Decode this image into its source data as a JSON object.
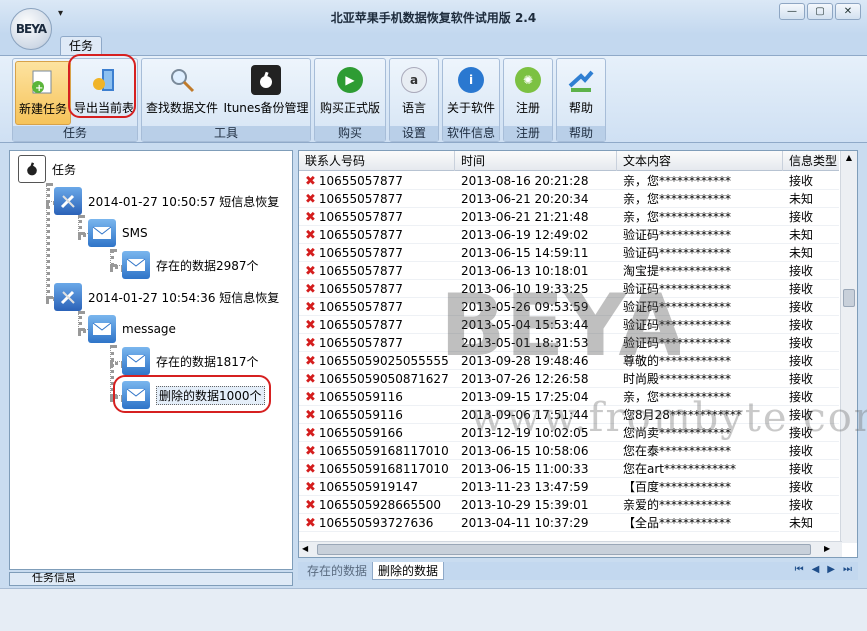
{
  "window": {
    "title": "北亚苹果手机数据恢复软件试用版 2.4",
    "logo": "BEYA",
    "qat_symbol": "▾"
  },
  "ribbon": {
    "tab": "任务",
    "groups": [
      {
        "label": "任务",
        "buttons": [
          {
            "label": "新建任务",
            "icon": "new-task-icon"
          },
          {
            "label": "导出当前表",
            "icon": "export-icon"
          }
        ]
      },
      {
        "label": "工具",
        "buttons": [
          {
            "label": "查找数据文件",
            "icon": "search-icon"
          },
          {
            "label": "Itunes备份管理",
            "icon": "apple-icon"
          }
        ]
      },
      {
        "label": "购买",
        "buttons": [
          {
            "label": "购买正式版",
            "icon": "play-icon"
          }
        ]
      },
      {
        "label": "设置",
        "buttons": [
          {
            "label": "语言",
            "icon": "language-icon"
          }
        ]
      },
      {
        "label": "软件信息",
        "buttons": [
          {
            "label": "关于软件",
            "icon": "info-icon"
          }
        ]
      },
      {
        "label": "注册",
        "buttons": [
          {
            "label": "注册",
            "icon": "register-icon"
          }
        ]
      },
      {
        "label": "帮助",
        "buttons": [
          {
            "label": "帮助",
            "icon": "help-icon"
          }
        ]
      }
    ]
  },
  "tree": {
    "root": "任务",
    "task1": "2014-01-27 10:50:57 短信息恢复",
    "task1_sms": "SMS",
    "task1_existing": "存在的数据2987个",
    "task2": "2014-01-27 10:54:36 短信息恢复",
    "task2_message": "message",
    "task2_existing": "存在的数据1817个",
    "task2_deleted": "删除的数据1000个",
    "bottom_label": "任务信息"
  },
  "table": {
    "headers": [
      "联系人号码",
      "时间",
      "文本内容",
      "信息类型"
    ],
    "rows": [
      [
        "10655057877",
        "2013-08-16  20:21:28",
        "亲，您************",
        "接收"
      ],
      [
        "10655057877",
        "2013-06-21  20:20:34",
        "亲，您************",
        "未知"
      ],
      [
        "10655057877",
        "2013-06-21  21:21:48",
        "亲，您************",
        "接收"
      ],
      [
        "10655057877",
        "2013-06-19  12:49:02",
        "验证码************",
        "未知"
      ],
      [
        "10655057877",
        "2013-06-15  14:59:11",
        "验证码************",
        "未知"
      ],
      [
        "10655057877",
        "2013-06-13  10:18:01",
        "淘宝提************",
        "接收"
      ],
      [
        "10655057877",
        "2013-06-10  19:33:25",
        "验证码************",
        "接收"
      ],
      [
        "10655057877",
        "2013-05-26  09:53:59",
        "验证码************",
        "接收"
      ],
      [
        "10655057877",
        "2013-05-04  15:53:44",
        "验证码************",
        "接收"
      ],
      [
        "10655057877",
        "2013-05-01  18:31:53",
        "验证码************",
        "接收"
      ],
      [
        "10655059025055555",
        "2013-09-28  19:48:46",
        "尊敬的************",
        "接收"
      ],
      [
        "10655059050871627",
        "2013-07-26  12:26:58",
        "时尚殿************",
        "接收"
      ],
      [
        "10655059116",
        "2013-09-15  17:25:04",
        "亲，您************",
        "接收"
      ],
      [
        "10655059116",
        "2013-09-06  17:51:44",
        "您8月28************",
        "接收"
      ],
      [
        "10655059166",
        "2013-12-19  10:02:05",
        "您尚卖************",
        "接收"
      ],
      [
        "10655059168117010",
        "2013-06-15  10:58:06",
        "您在泰************",
        "接收"
      ],
      [
        "10655059168117010",
        "2013-06-15  11:00:33",
        "您在art************",
        "接收"
      ],
      [
        "106550591914​7",
        "2013-11-23  13:47:59",
        "【百度************",
        "接收"
      ],
      [
        "10655059286655​00",
        "2013-10-29  15:39:01",
        "亲爱的************",
        "接收"
      ],
      [
        "10655059372763​6",
        "2013-04-11  10:37:29",
        "【全品************",
        "未知"
      ]
    ]
  },
  "watermark": {
    "text": "BEYA",
    "url": "www.frombyte.com"
  },
  "bottom_tabs": [
    "存在的数据",
    "删除的数据"
  ],
  "nav": [
    "⏮",
    "◀",
    "▶",
    "⏭"
  ]
}
